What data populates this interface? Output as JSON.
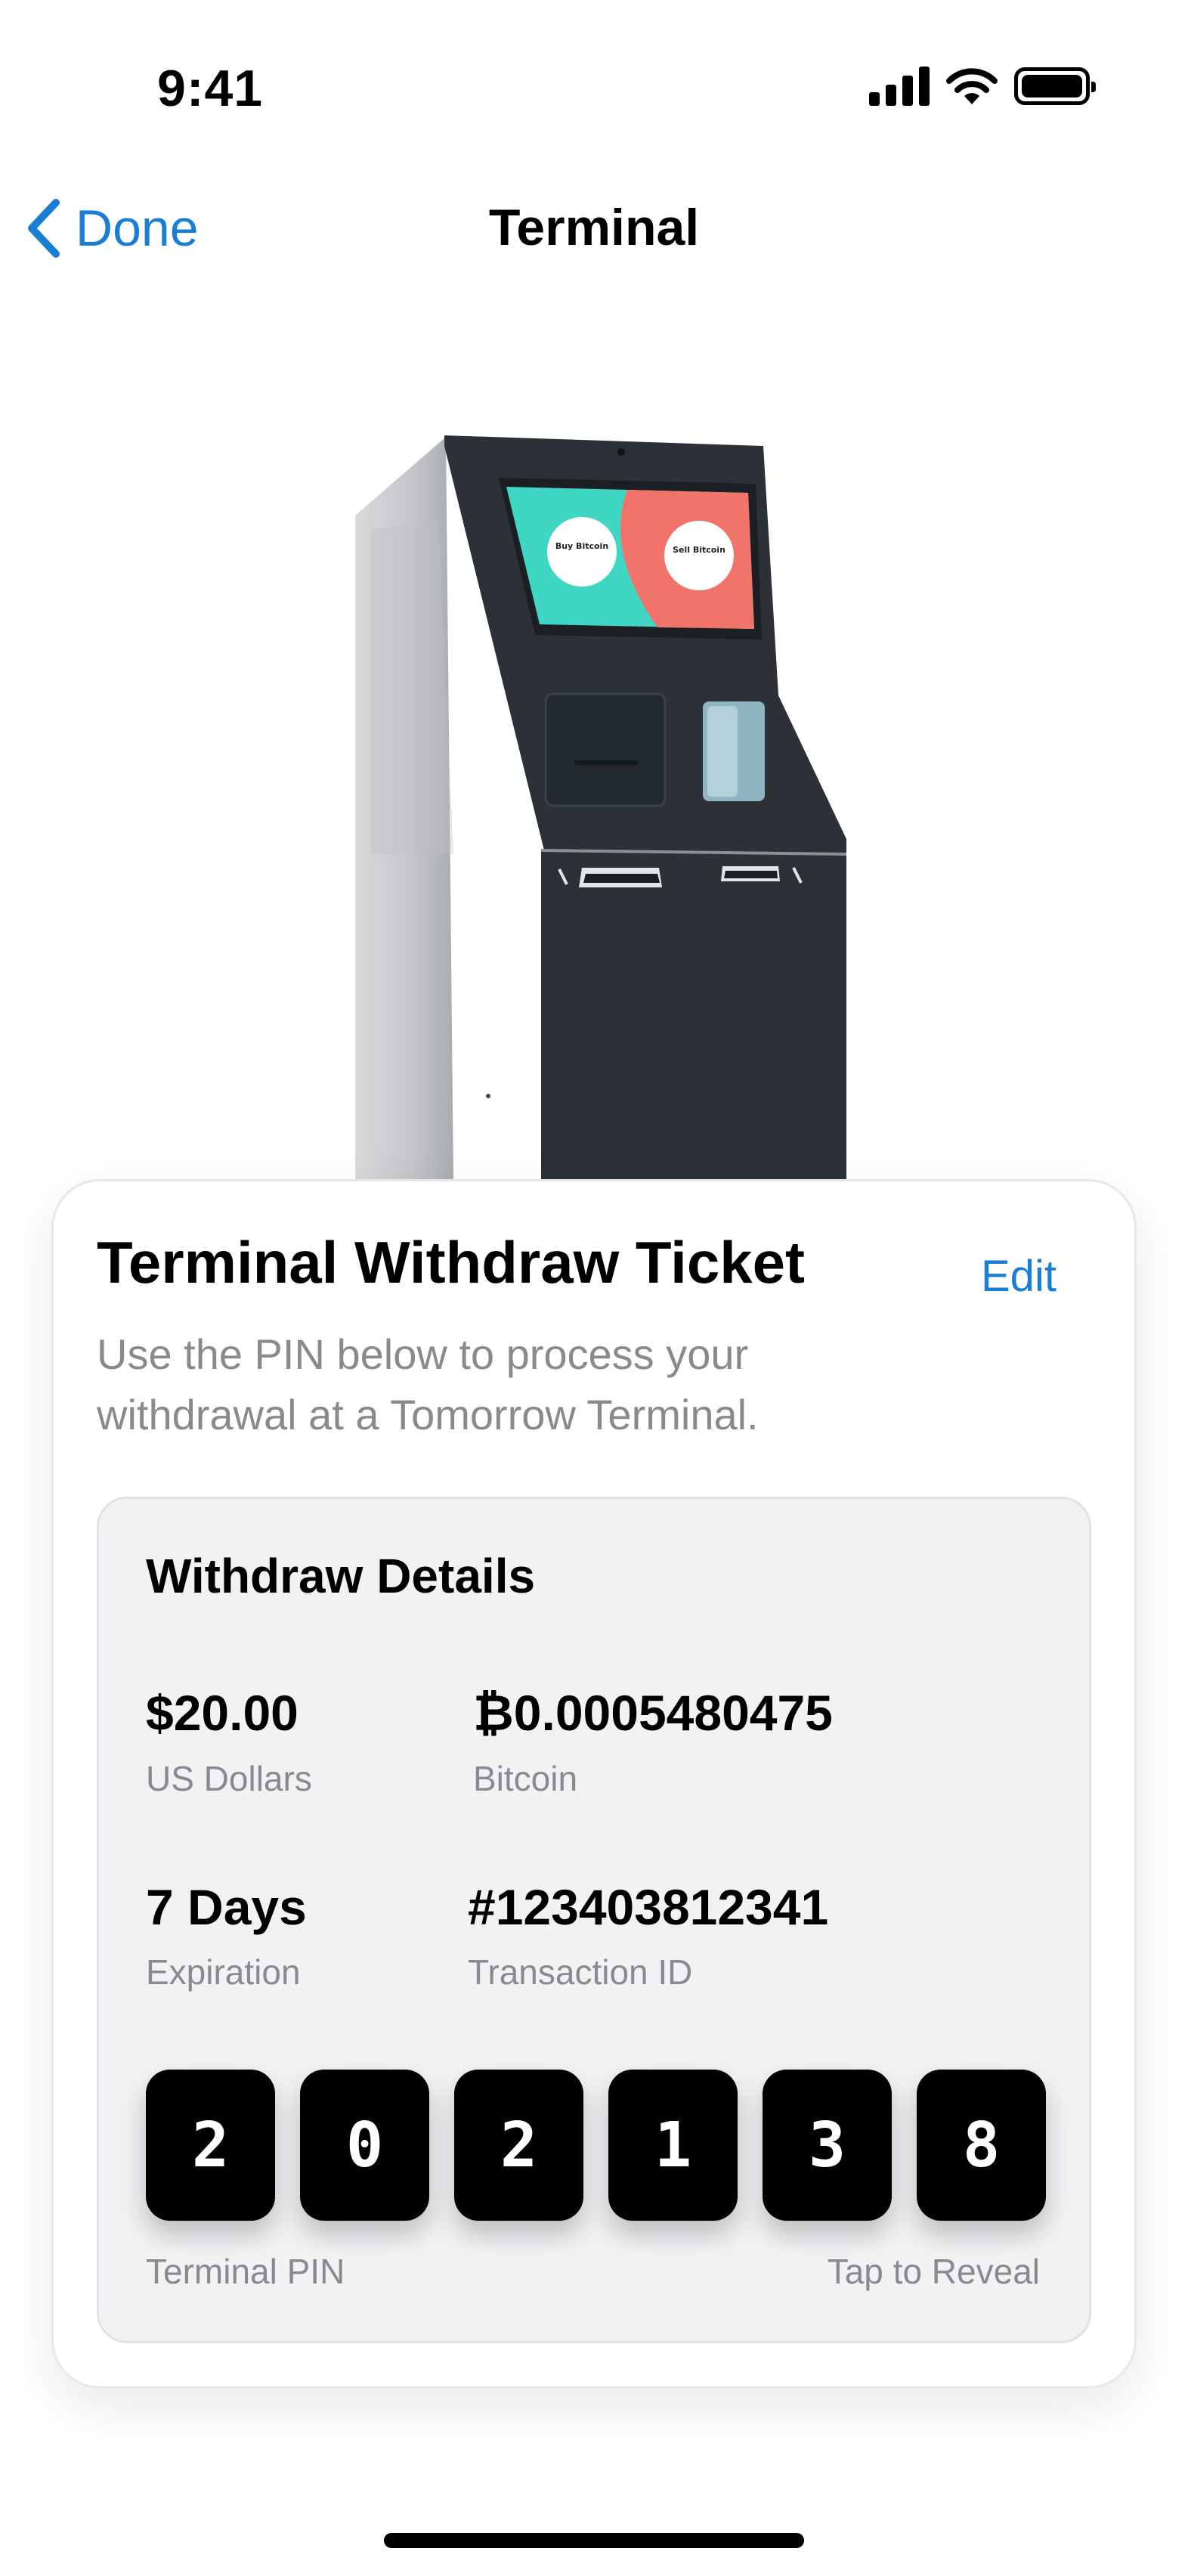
{
  "status_bar": {
    "time": "9:41"
  },
  "nav": {
    "back_label": "Done",
    "title": "Terminal"
  },
  "machine": {
    "screen_left_label": "Buy Bitcoin",
    "screen_right_label": "Sell Bitcoin"
  },
  "card": {
    "title": "Terminal Withdraw Ticket",
    "edit_label": "Edit",
    "description": "Use the PIN below to process your withdrawal at a Tomorrow Terminal."
  },
  "details": {
    "title": "Withdraw Details",
    "usd_amount": "$20.00",
    "usd_label": "US Dollars",
    "btc_amount": "₿0.0005480475",
    "btc_label": "Bitcoin",
    "expiration_value": "7 Days",
    "expiration_label": "Expiration",
    "transaction_id": "#123403812341",
    "transaction_label": "Transaction ID",
    "pin_digits": [
      "2",
      "0",
      "2",
      "1",
      "3",
      "8"
    ],
    "pin_label": "Terminal PIN",
    "reveal_label": "Tap to Reveal"
  },
  "colors": {
    "accent": "#1a7fd4",
    "secondary_text": "#8a8a8e",
    "machine_body": "#2b3136",
    "screen_teal": "#3fd6c4",
    "screen_coral": "#f0746a"
  }
}
